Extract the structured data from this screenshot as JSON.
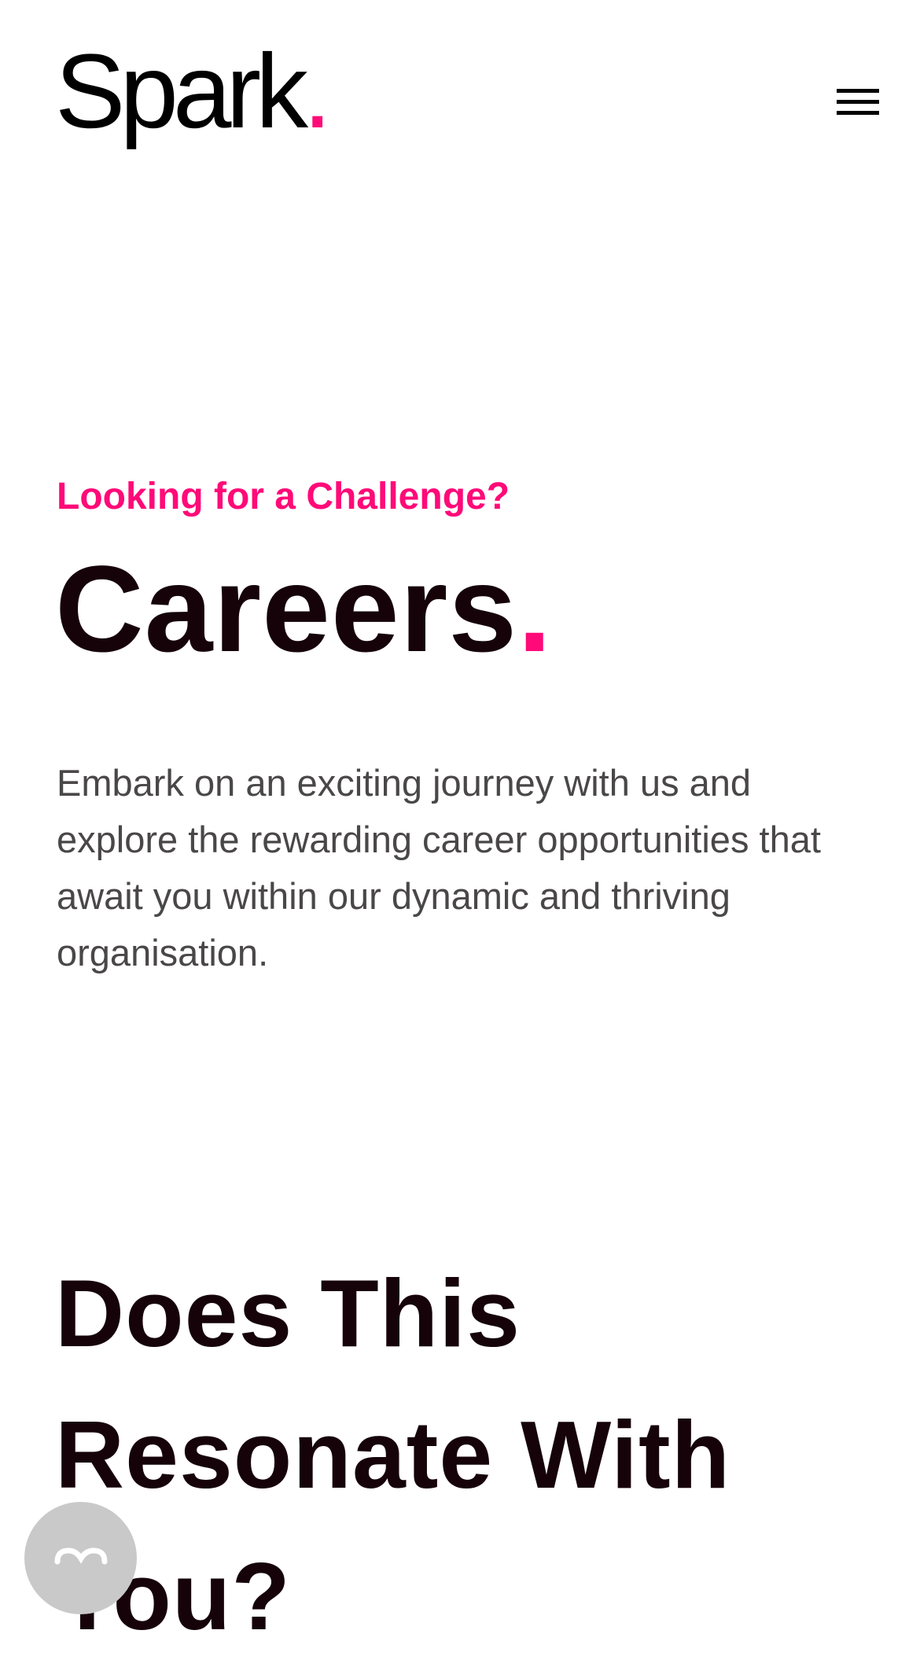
{
  "header": {
    "logo_text": "Spark",
    "logo_dot": ".",
    "menu_icon": "hamburger-menu-icon"
  },
  "hero": {
    "eyebrow": "Looking for a Challenge?",
    "title": "Careers",
    "title_dot": ".",
    "intro": "Embark on an exciting journey with us and explore the rewarding career opportunities that await you within our dynamic and thriving organisation."
  },
  "section": {
    "title": "Does This Resonate With You?"
  },
  "floating_button": {
    "icon": "accessibility-icon"
  },
  "colors": {
    "accent": "#ff0a78",
    "heading": "#16030a",
    "body_text": "#4a4748",
    "floating_button": "#c9c9c9"
  }
}
